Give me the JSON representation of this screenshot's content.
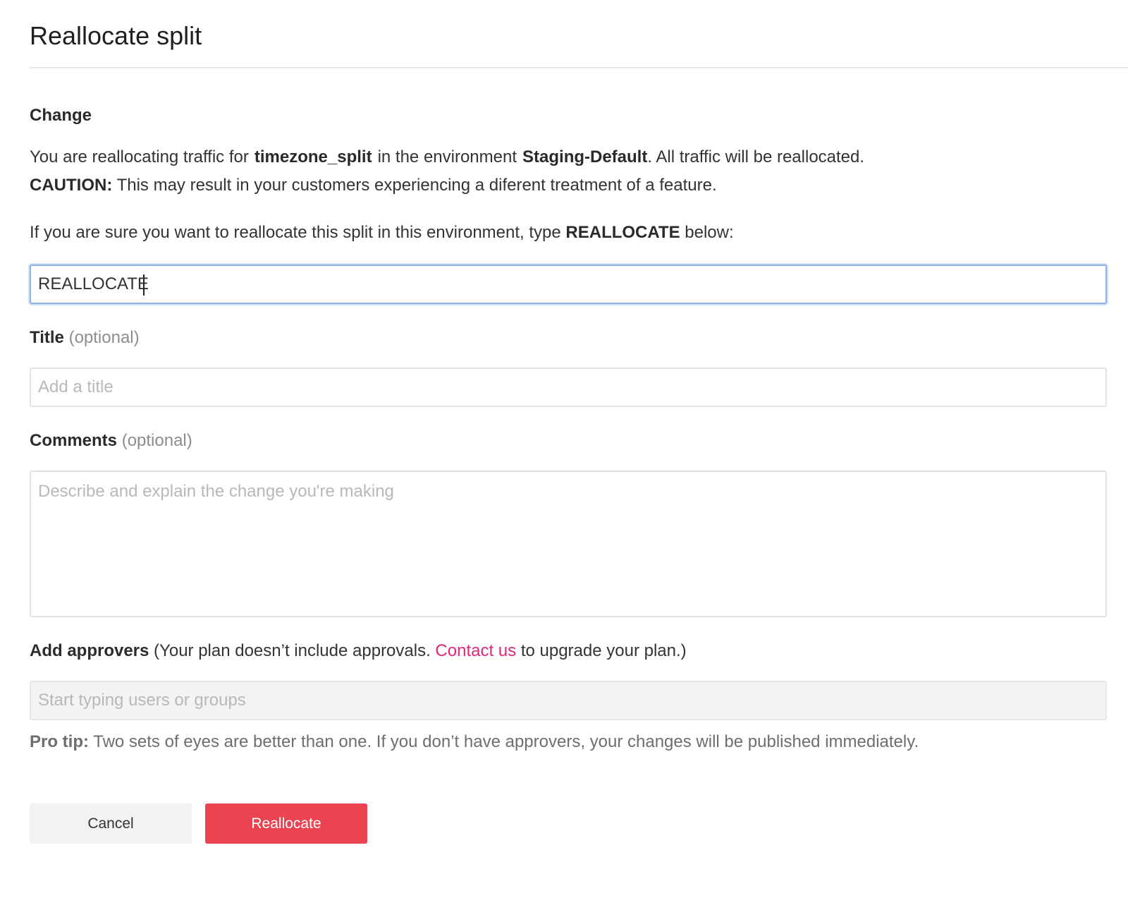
{
  "dialog": {
    "title": "Reallocate split"
  },
  "change": {
    "heading": "Change",
    "line1": {
      "prefix": "You are reallocating traffic for",
      "split_name": "timezone_split",
      "middle": "in the environment",
      "environment": "Staging-Default",
      "suffix": ".  All traffic will be reallocated."
    },
    "caution": {
      "label": "CAUTION:",
      "text": " This may result in your customers experiencing a diferent treatment of a feature."
    },
    "confirm_prompt": {
      "prefix": "If you are sure you want to reallocate this split in this environment, type ",
      "keyword": "REALLOCATE",
      "suffix": " below:"
    },
    "confirm_value": "REALLOCATE"
  },
  "title_field": {
    "label": "Title",
    "optional": "(optional)",
    "placeholder": "Add a title",
    "value": ""
  },
  "comments_field": {
    "label": "Comments",
    "optional": "(optional)",
    "placeholder": "Describe and explain the change you're making",
    "value": ""
  },
  "approvers": {
    "label": "Add approvers",
    "note_prefix": " (Your plan doesn’t include approvals. ",
    "link": "Contact us",
    "note_suffix": " to upgrade your plan.)",
    "placeholder": "Start typing users or groups"
  },
  "pro_tip": {
    "label": "Pro tip:",
    "text": "  Two sets of eyes are better than one. If you don’t have approvers, your changes will be published immediately."
  },
  "buttons": {
    "cancel": "Cancel",
    "reallocate": "Reallocate"
  },
  "colors": {
    "primary_button": "#ea4351",
    "link": "#e0287a",
    "focus_border": "#8fb3e0"
  }
}
